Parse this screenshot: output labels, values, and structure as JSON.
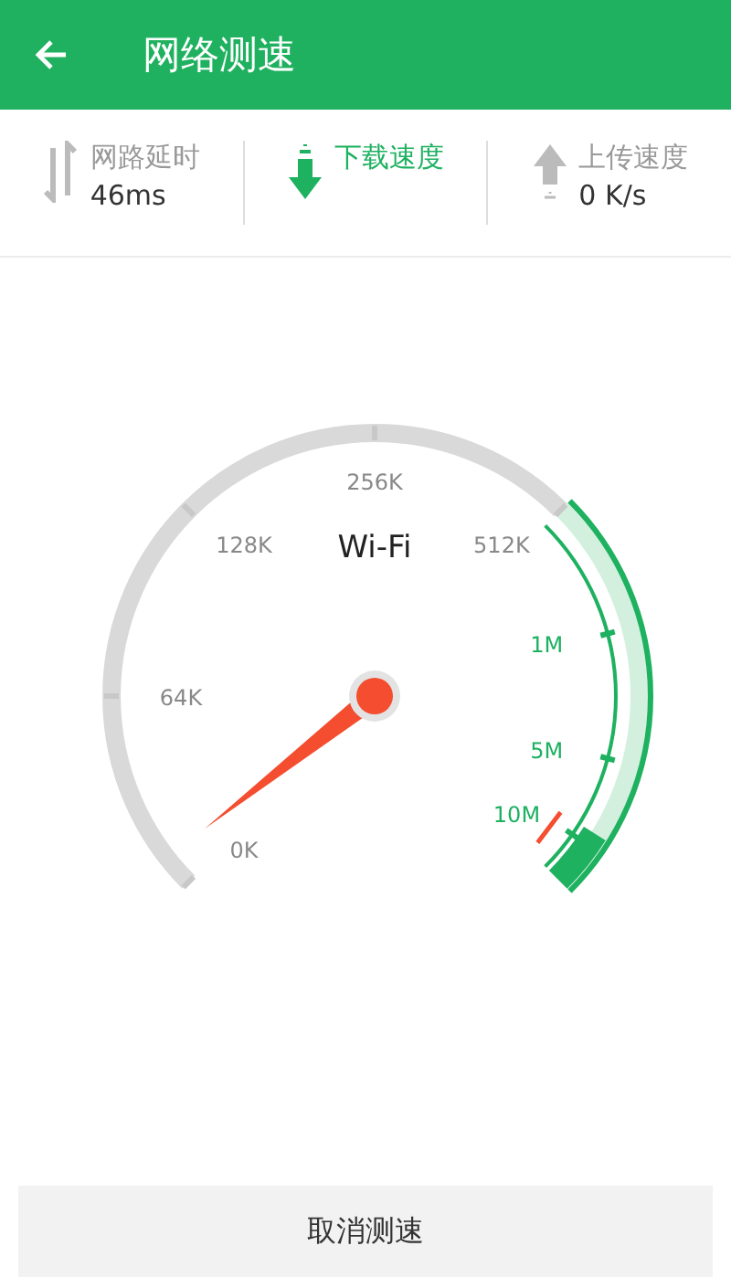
{
  "header": {
    "title": "网络测速"
  },
  "stats": [
    {
      "kind": "latency",
      "label": "网路延时",
      "value": "46ms",
      "selected": false
    },
    {
      "kind": "download",
      "label": "下载速度",
      "selected": true
    },
    {
      "kind": "upload",
      "label": "上传速度",
      "value": "0 K/s",
      "selected": false
    }
  ],
  "gauge": {
    "network": "Wi-Fi",
    "scale": [
      {
        "label": "0K",
        "kind": "low"
      },
      {
        "label": "64K",
        "kind": "low"
      },
      {
        "label": "128K",
        "kind": "low"
      },
      {
        "label": "256K",
        "kind": "low"
      },
      {
        "label": "512K",
        "kind": "low"
      },
      {
        "label": "1M",
        "kind": "high"
      },
      {
        "label": "5M",
        "kind": "high"
      },
      {
        "label": "10M",
        "kind": "high"
      }
    ]
  },
  "cancel_button": "取消测速"
}
